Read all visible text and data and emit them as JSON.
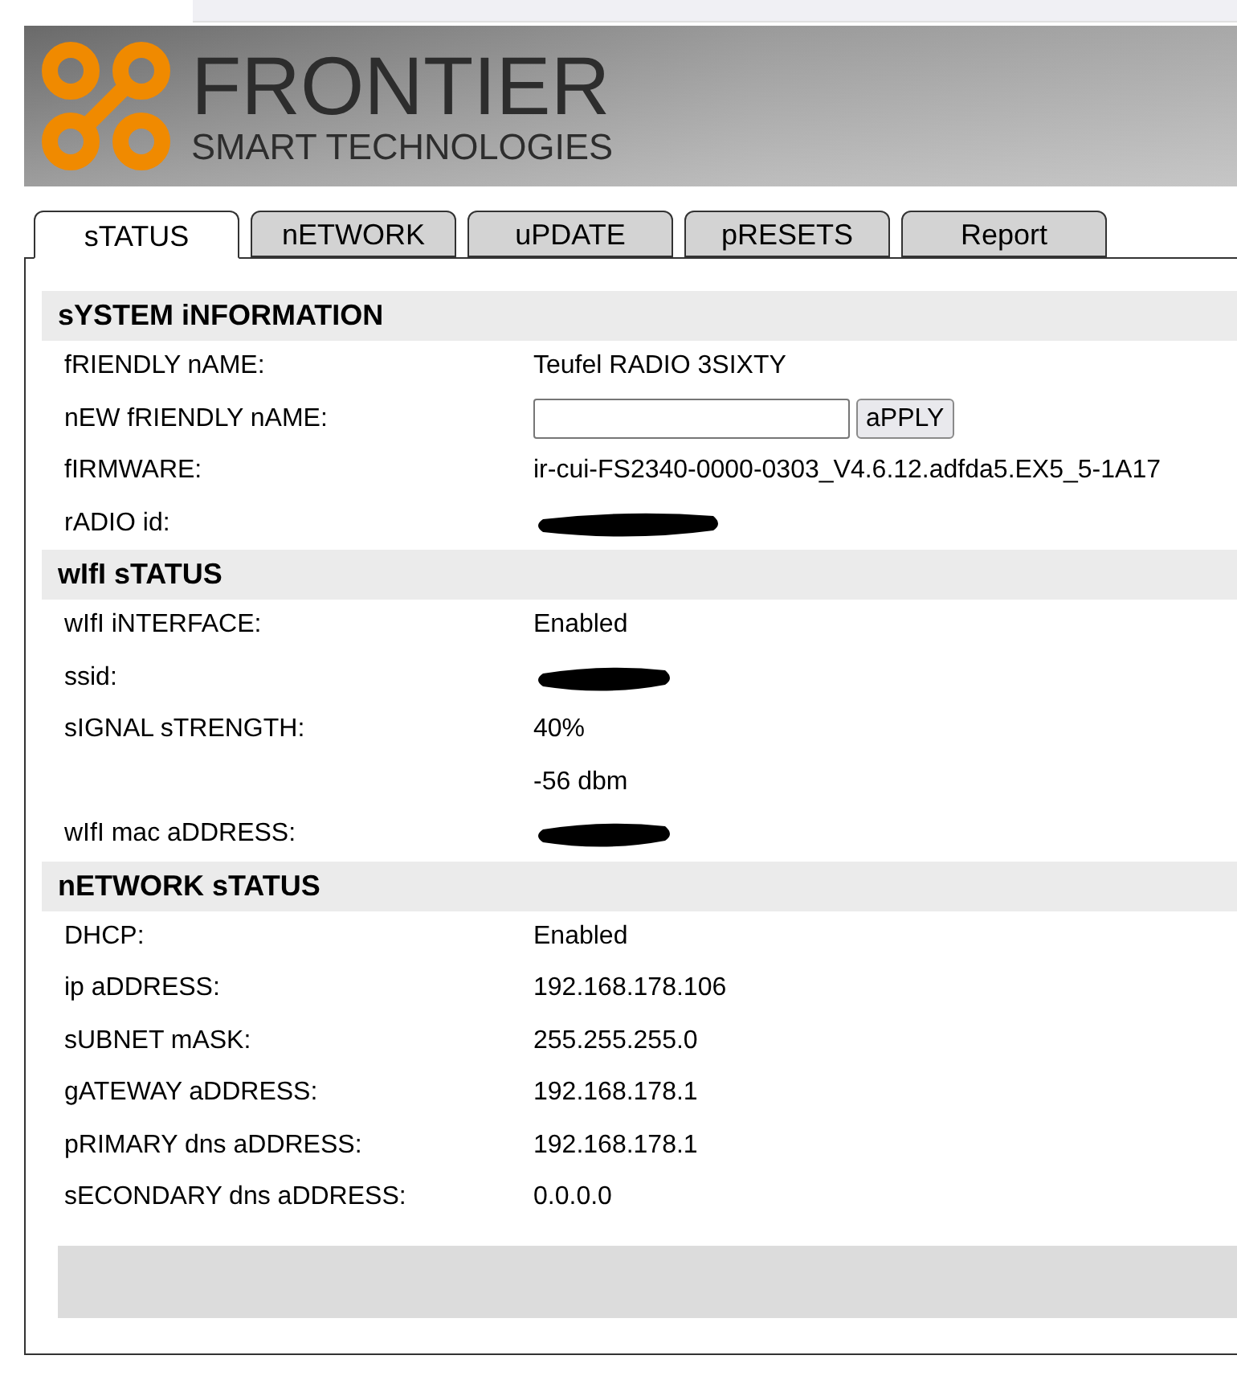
{
  "logo": {
    "name": "FRONTIER",
    "tagline": "SMART TECHNOLOGIES"
  },
  "tabs": [
    {
      "label": "sTATUS",
      "selected": true
    },
    {
      "label": "nETWORK",
      "selected": false
    },
    {
      "label": "uPDATE",
      "selected": false
    },
    {
      "label": "pRESETS",
      "selected": false
    },
    {
      "label": "Report",
      "selected": false
    }
  ],
  "sections": [
    {
      "title": "sYSTEM iNFORMATION",
      "rows": [
        {
          "kind": "text",
          "label": "fRIENDLY nAME:",
          "value": "Teufel RADIO 3SIXTY"
        },
        {
          "kind": "input",
          "label": "nEW fRIENDLY nAME:",
          "button": "aPPLY"
        },
        {
          "kind": "text",
          "label": "fIRMWARE:",
          "value": "ir-cui-FS2340-0000-0303_V4.6.12.adfda5.EX5_5-1A17"
        },
        {
          "kind": "redacted",
          "label": "rADIO id:"
        }
      ]
    },
    {
      "title": "wIfI sTATUS",
      "rows": [
        {
          "kind": "text",
          "label": "wIfI iNTERFACE:",
          "value": "Enabled"
        },
        {
          "kind": "redacted",
          "label": "ssid:"
        },
        {
          "kind": "text",
          "label": "sIGNAL sTRENGTH:",
          "value": "40%"
        },
        {
          "kind": "text",
          "value": "-56 dbm"
        },
        {
          "kind": "redacted",
          "label": "wIfI mac aDDRESS:"
        }
      ]
    },
    {
      "title": "nETWORK sTATUS",
      "rows": [
        {
          "kind": "text",
          "label": "DHCP:",
          "value": "Enabled"
        },
        {
          "kind": "text",
          "label": "ip aDDRESS:",
          "value": "192.168.178.106"
        },
        {
          "kind": "text",
          "label": "sUBNET mASK:",
          "value": "255.255.255.0"
        },
        {
          "kind": "text",
          "label": "gATEWAY aDDRESS:",
          "value": "192.168.178.1"
        },
        {
          "kind": "text",
          "label": "pRIMARY dns aDDRESS:",
          "value": "192.168.178.1"
        },
        {
          "kind": "text",
          "label": "sECONDARY dns aDDRESS:",
          "value": "0.0.0.0"
        }
      ]
    }
  ]
}
